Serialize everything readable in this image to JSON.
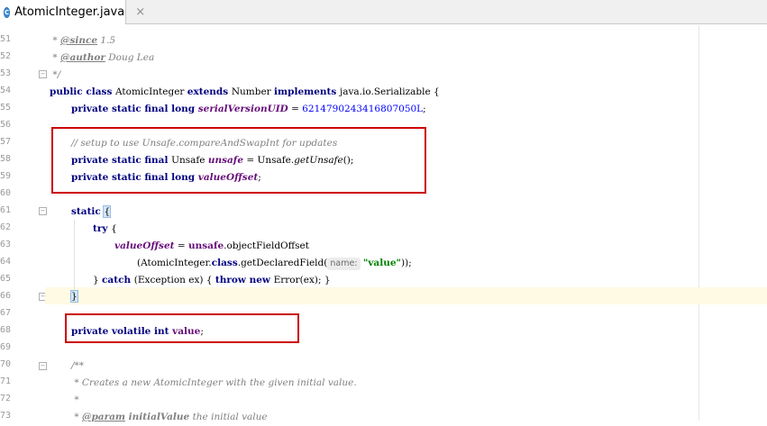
{
  "tab": {
    "title": "AtomicInteger.java",
    "icon": "java-class-icon",
    "close": "×"
  },
  "gutter": {
    "line_numbers": [
      "51",
      "52",
      "53",
      "54",
      "55",
      "56",
      "57",
      "58",
      "59",
      "60",
      "61",
      "62",
      "63",
      "64",
      "65",
      "66",
      "67",
      "68",
      "69",
      "70",
      "71",
      "72",
      "73"
    ]
  },
  "code": {
    "l51": {
      "prefix": " * ",
      "tag": "@since",
      "rest": " 1.5"
    },
    "l52": {
      "prefix": " * ",
      "tag": "@author",
      "rest": " Doug Lea"
    },
    "l53": " */",
    "l54": {
      "kw1": "public class ",
      "name": "AtomicInteger ",
      "kw2": "extends ",
      "parent": "Number ",
      "kw3": "implements ",
      "iface": "java.io.Serializable {"
    },
    "l55": {
      "kw": "private static final long ",
      "field": "serialVersionUID",
      "eq": " = ",
      "num": "6214790243416807050L",
      "end": ";"
    },
    "l57": "// setup to use Unsafe.compareAndSwapInt for updates",
    "l58": {
      "kw": "private static final ",
      "type": "Unsafe ",
      "field": "unsafe",
      "eq": " = Unsafe.",
      "meth": "getUnsafe",
      "end": "();"
    },
    "l59": {
      "kw": "private static final long ",
      "field": "valueOffset",
      "end": ";"
    },
    "l61": {
      "kw": "static ",
      "brace": "{"
    },
    "l62": {
      "kw": "try ",
      "rest": "{"
    },
    "l63": {
      "field": "valueOffset",
      "eq": " = ",
      "field2": "unsafe",
      "rest": ".objectFieldOffset"
    },
    "l64": {
      "pre": "(AtomicInteger.",
      "kw": "class",
      "mid": ".getDeclaredField(",
      "hint": "name:",
      "str": "\"value\"",
      "end": "));"
    },
    "l65": {
      "pre": "} ",
      "kw1": "catch ",
      "mid": "(Exception ex) { ",
      "kw2": "throw new ",
      "end": "Error(ex); }"
    },
    "l66": "}",
    "l68": {
      "kw": "private volatile int ",
      "field": "value",
      "end": ";"
    },
    "l70": "/**",
    "l71": " * Creates a new AtomicInteger with the given initial value.",
    "l72": " *",
    "l73": {
      "prefix": " * ",
      "tag": "@param",
      "param": " initialValue",
      "rest": " the initial value"
    }
  },
  "colors": {
    "keyword": "#000080",
    "field": "#660e7a",
    "number": "#0000ff",
    "string": "#008000",
    "comment": "#808080",
    "highlight_box": "#cc0000"
  }
}
